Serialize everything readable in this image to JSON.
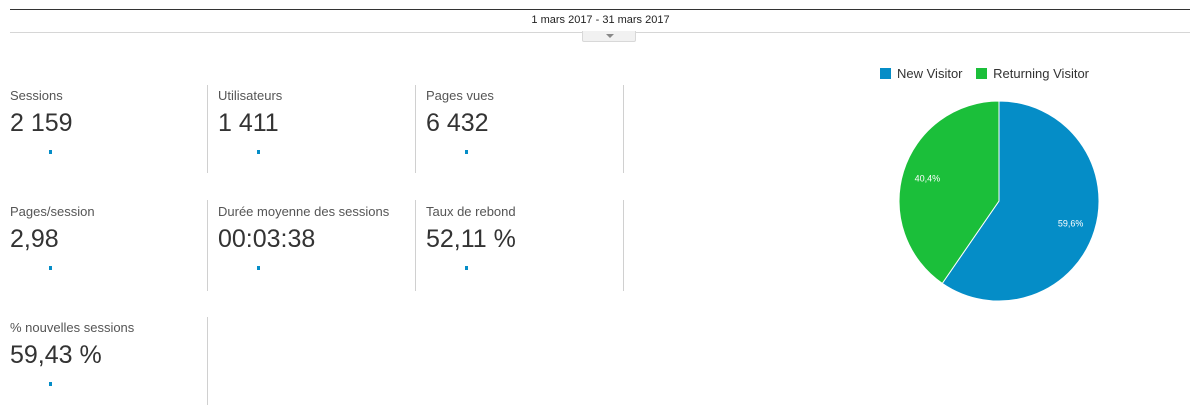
{
  "date_range": "1 mars 2017 - 31 mars 2017",
  "metrics": [
    {
      "label": "Sessions",
      "value": "2 159"
    },
    {
      "label": "Utilisateurs",
      "value": "1 411"
    },
    {
      "label": "Pages vues",
      "value": "6 432"
    },
    {
      "label": "Pages/session",
      "value": "2,98"
    },
    {
      "label": "Durée moyenne des sessions",
      "value": "00:03:38"
    },
    {
      "label": "Taux de rebond",
      "value": "52,11 %"
    },
    {
      "label": "% nouvelles sessions",
      "value": "59,43 %"
    }
  ],
  "chart_data": {
    "type": "pie",
    "series": [
      {
        "name": "New Visitor",
        "value": 59.6,
        "label": "59,6%",
        "color": "#058dc7"
      },
      {
        "name": "Returning Visitor",
        "value": 40.4,
        "label": "40,4%",
        "color": "#1bbf3a"
      }
    ],
    "legend_position": "top"
  }
}
